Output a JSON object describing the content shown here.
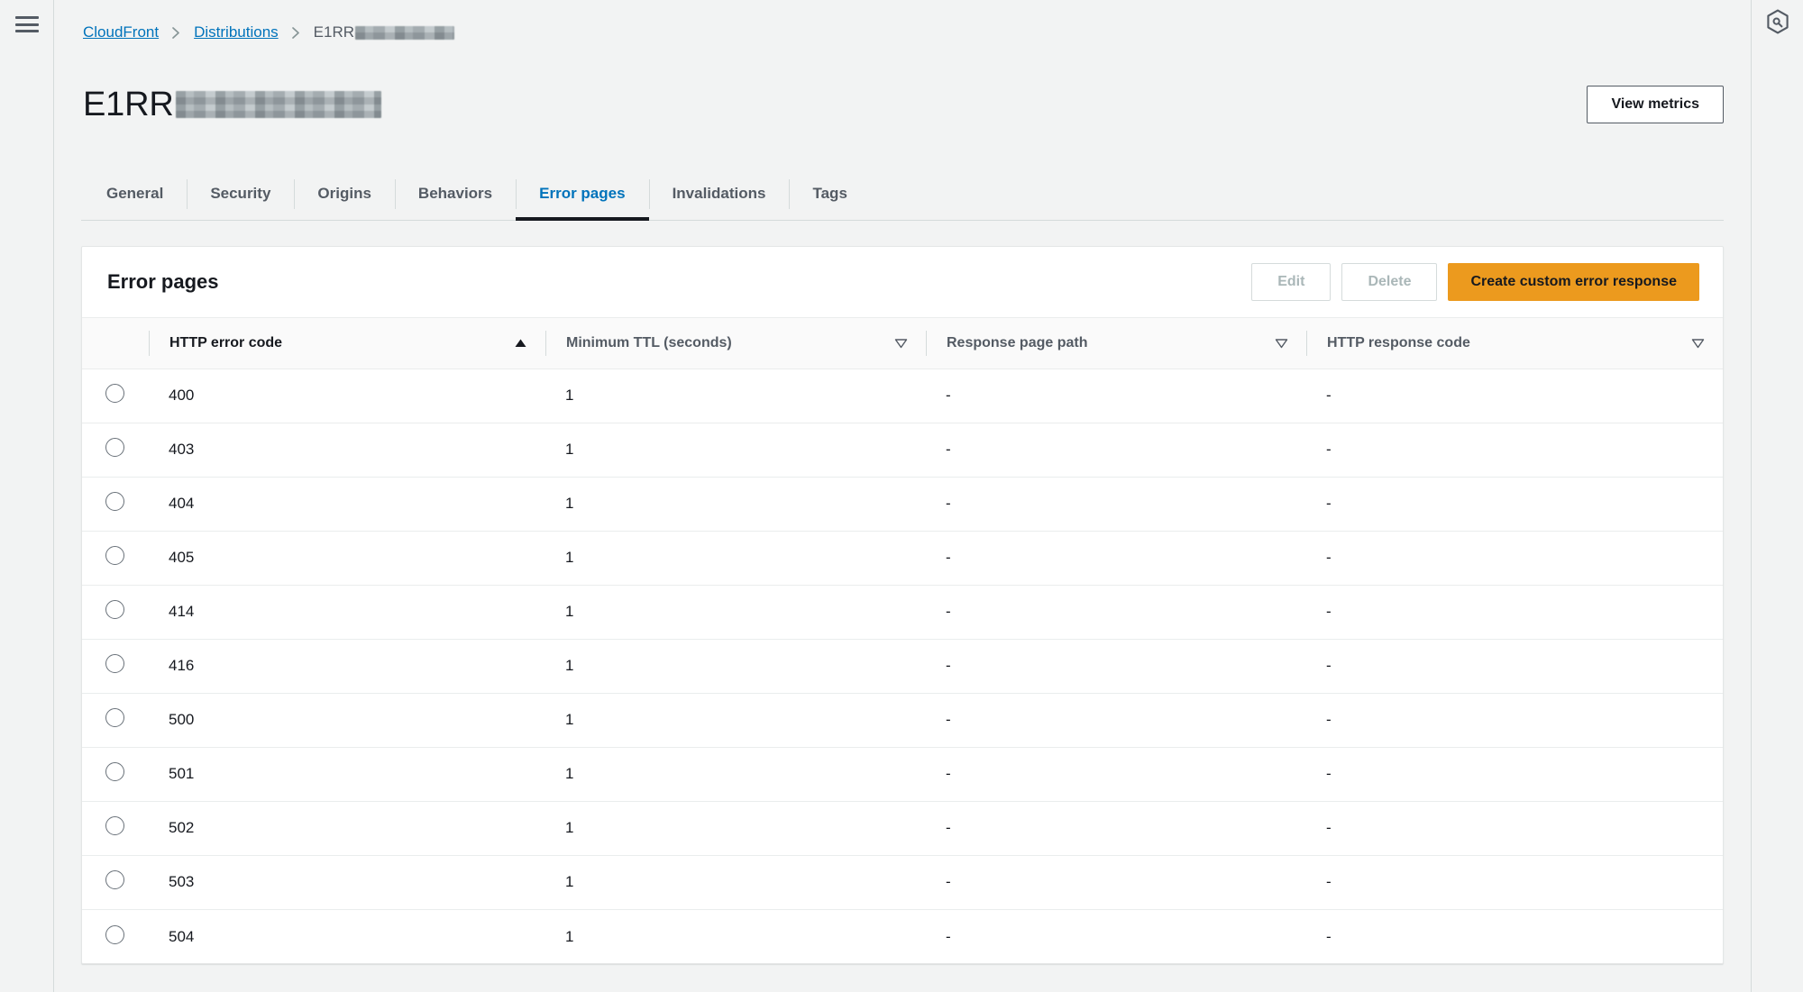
{
  "nav": {
    "menu_icon": "hamburger-menu-icon",
    "help_icon": "cloudshell-hexagon-icon"
  },
  "breadcrumb": {
    "items": [
      {
        "label": "CloudFront",
        "link": true
      },
      {
        "label": "Distributions",
        "link": true
      },
      {
        "label": "E1RR",
        "link": false,
        "redacted": true
      }
    ]
  },
  "header": {
    "title": "E1RR",
    "title_redacted": true,
    "view_metrics_label": "View metrics"
  },
  "tabs": [
    {
      "label": "General",
      "active": false
    },
    {
      "label": "Security",
      "active": false
    },
    {
      "label": "Origins",
      "active": false
    },
    {
      "label": "Behaviors",
      "active": false
    },
    {
      "label": "Error pages",
      "active": true
    },
    {
      "label": "Invalidations",
      "active": false
    },
    {
      "label": "Tags",
      "active": false
    }
  ],
  "panel": {
    "title": "Error pages",
    "actions": {
      "edit_label": "Edit",
      "edit_disabled": true,
      "delete_label": "Delete",
      "delete_disabled": true,
      "create_label": "Create custom error response"
    }
  },
  "table": {
    "columns": [
      {
        "key": "http_error_code",
        "label": "HTTP error code",
        "sort": "asc",
        "sort_icon": "sort-ascending-icon",
        "active": true
      },
      {
        "key": "minimum_ttl",
        "label": "Minimum TTL (seconds)",
        "sort": "none",
        "sort_icon": "sort-icon",
        "active": false
      },
      {
        "key": "response_page_path",
        "label": "Response page path",
        "sort": "none",
        "sort_icon": "sort-icon",
        "active": false
      },
      {
        "key": "http_response_code",
        "label": "HTTP response code",
        "sort": "none",
        "sort_icon": "sort-icon",
        "active": false
      }
    ],
    "rows": [
      {
        "selected": false,
        "http_error_code": "400",
        "minimum_ttl": "1",
        "response_page_path": "-",
        "http_response_code": "-"
      },
      {
        "selected": false,
        "http_error_code": "403",
        "minimum_ttl": "1",
        "response_page_path": "-",
        "http_response_code": "-"
      },
      {
        "selected": false,
        "http_error_code": "404",
        "minimum_ttl": "1",
        "response_page_path": "-",
        "http_response_code": "-"
      },
      {
        "selected": false,
        "http_error_code": "405",
        "minimum_ttl": "1",
        "response_page_path": "-",
        "http_response_code": "-"
      },
      {
        "selected": false,
        "http_error_code": "414",
        "minimum_ttl": "1",
        "response_page_path": "-",
        "http_response_code": "-"
      },
      {
        "selected": false,
        "http_error_code": "416",
        "minimum_ttl": "1",
        "response_page_path": "-",
        "http_response_code": "-"
      },
      {
        "selected": false,
        "http_error_code": "500",
        "minimum_ttl": "1",
        "response_page_path": "-",
        "http_response_code": "-"
      },
      {
        "selected": false,
        "http_error_code": "501",
        "minimum_ttl": "1",
        "response_page_path": "-",
        "http_response_code": "-"
      },
      {
        "selected": false,
        "http_error_code": "502",
        "minimum_ttl": "1",
        "response_page_path": "-",
        "http_response_code": "-"
      },
      {
        "selected": false,
        "http_error_code": "503",
        "minimum_ttl": "1",
        "response_page_path": "-",
        "http_response_code": "-"
      },
      {
        "selected": false,
        "http_error_code": "504",
        "minimum_ttl": "1",
        "response_page_path": "-",
        "http_response_code": "-"
      }
    ]
  },
  "colors": {
    "page_background": "#f2f3f3",
    "panel_background": "#ffffff",
    "link": "#0073bb",
    "accent_primary": "#ec9a1e",
    "text_primary": "#16191f",
    "text_secondary": "#545b64",
    "border": "#d5dbdb",
    "row_divider": "#eaeded",
    "disabled_text": "#aab7b8"
  }
}
